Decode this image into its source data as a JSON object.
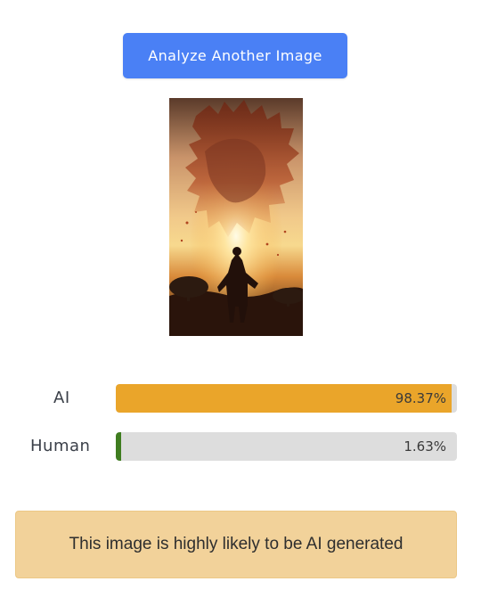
{
  "actions": {
    "analyze_label": "Analyze Another Image"
  },
  "preview": {
    "icon": "uploaded-image-preview",
    "description_colors": {
      "sky": "#f0c27a",
      "sun": "#fff6d8",
      "silhouette": "#2b1610",
      "ember": "#b0451f"
    }
  },
  "results": [
    {
      "label": "AI",
      "value_text": "98.37%",
      "fraction": 0.9837,
      "color": "#eaa52a"
    },
    {
      "label": "Human",
      "value_text": "1.63%",
      "fraction": 0.0163,
      "color": "#3f7d20"
    }
  ],
  "verdict": {
    "text": "This image is highly likely to be AI generated",
    "color": "#f2d29a"
  }
}
